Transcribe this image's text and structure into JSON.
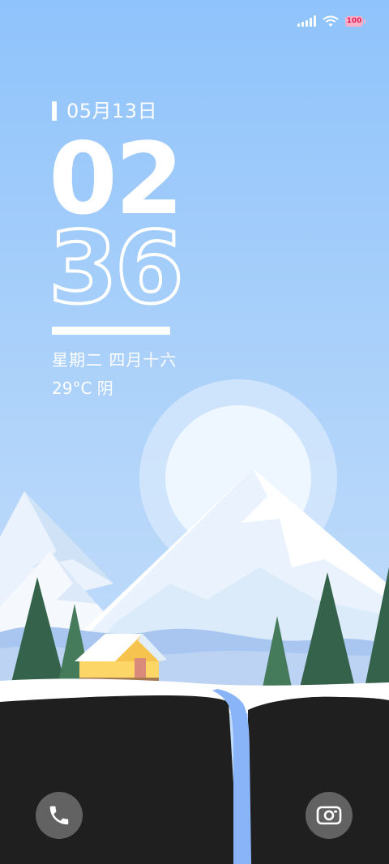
{
  "status_bar": {
    "signal_icon": "signal-bars-icon",
    "wifi_icon": "wifi-icon",
    "battery_icon": "battery-icon",
    "battery_level": "100"
  },
  "lock_screen": {
    "date": "05月13日",
    "hours": "02",
    "minutes": "36",
    "lunar_date": "星期二 四月十六",
    "weather": "29°C 阴"
  },
  "shortcuts": {
    "phone_icon": "phone-icon",
    "camera_icon": "camera-icon"
  },
  "colors": {
    "sky_top": "#90c4fb",
    "sky_bottom": "#bfdcfa",
    "ground": "#1f1f1f",
    "river": "#8ab4f8",
    "tree_dark": "#35624a",
    "house": "#fcd767"
  }
}
